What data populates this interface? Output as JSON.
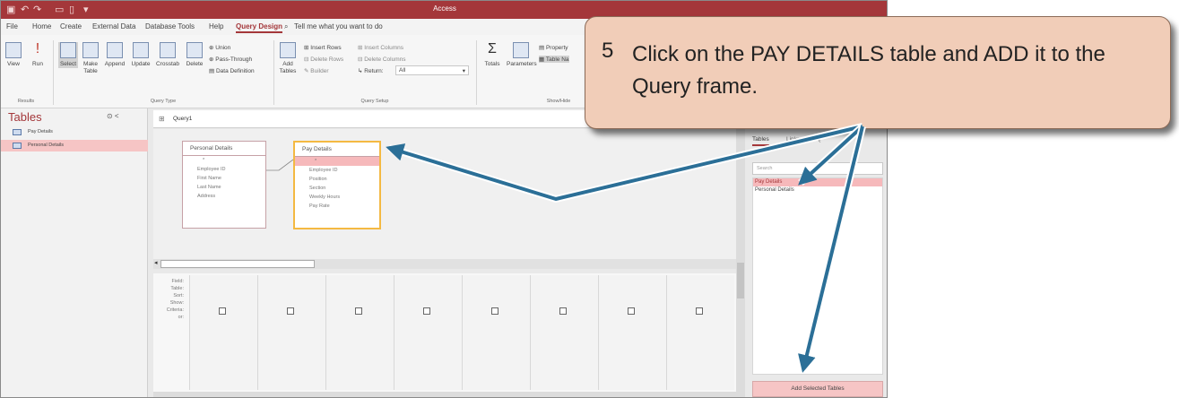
{
  "window": {
    "title": "Access"
  },
  "menu": [
    "File",
    "Home",
    "Create",
    "External Data",
    "Database Tools",
    "Help",
    "Query Design",
    "Tell me what you want to do"
  ],
  "ribbon": {
    "view": "View",
    "run": "Run",
    "select": "Select",
    "make_table": "Make Table",
    "append": "Append",
    "update": "Update",
    "crosstab": "Crosstab",
    "delete": "Delete",
    "union": "Union",
    "pass_through": "Pass-Through",
    "data_definition": "Data Definition",
    "add_tables": "Add Tables",
    "insert_rows": "Insert Rows",
    "delete_rows": "Delete Rows",
    "builder": "Builder",
    "insert_columns": "Insert Columns",
    "delete_columns": "Delete Columns",
    "return": "Return:",
    "return_value": "All",
    "totals": "Totals",
    "parameters": "Parameters",
    "property_sheet": "Property",
    "table_names": "Table Na",
    "groups": {
      "results": "Results",
      "query_type": "Query Type",
      "query_setup": "Query Setup",
      "show_hide": "Show/Hide"
    }
  },
  "nav": {
    "title": "Tables",
    "items": [
      {
        "label": "Pay Details",
        "selected": false
      },
      {
        "label": "Personal Details",
        "selected": true
      }
    ]
  },
  "query": {
    "tab": "Query1",
    "tables": [
      {
        "name": "Personal Details",
        "fields": [
          "*",
          "Employee ID",
          "First Name",
          "Last Name",
          "Address"
        ]
      },
      {
        "name": "Pay Details",
        "fields": [
          "*",
          "Employee ID",
          "Position",
          "Section",
          "Weekly Hours",
          "Pay Rate"
        ]
      }
    ],
    "grid_labels": [
      "Field:",
      "Table:",
      "Sort:",
      "Show:",
      "Criteria:",
      "or:"
    ]
  },
  "add_tables": {
    "tabs": [
      "Tables",
      "Links",
      "Q"
    ],
    "search_placeholder": "Search",
    "items": [
      {
        "label": "Pay Details",
        "selected": true
      },
      {
        "label": "Personal Details",
        "selected": false
      }
    ],
    "add_button": "Add Selected Tables"
  },
  "callout": {
    "number": "5",
    "text": "Click on the PAY DETAILS table and ADD it to the Query frame."
  },
  "colors": {
    "access_red": "#a4373a",
    "callout_fill": "#f1cdb8",
    "arrow": "#2b6f97",
    "highlight": "#f4b942"
  }
}
